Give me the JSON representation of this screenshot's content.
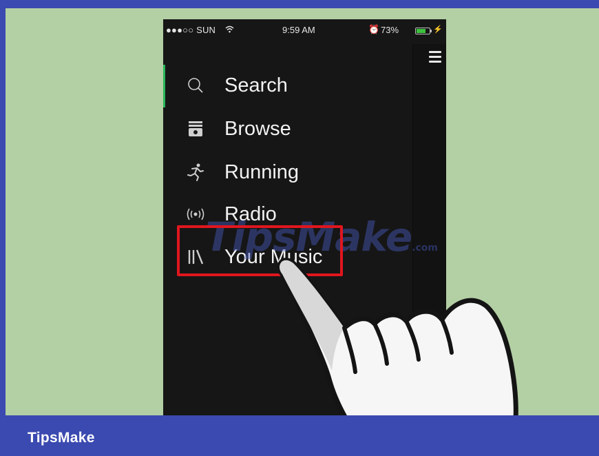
{
  "status_bar": {
    "carrier": "●●●○○ SUN",
    "wifi_icon": "wifi-icon",
    "time": "9:59 AM",
    "alarm_icon": "alarm-icon",
    "battery_percent": "73%",
    "battery_level": 0.73,
    "battery_color": "#3cc23c",
    "charging_icon": "bolt-icon"
  },
  "menu": {
    "items": [
      {
        "label": "Search",
        "icon": "search-icon",
        "active": true
      },
      {
        "label": "Browse",
        "icon": "browse-icon"
      },
      {
        "label": "Running",
        "icon": "running-icon"
      },
      {
        "label": "Radio",
        "icon": "radio-icon"
      },
      {
        "label": "Your Music",
        "icon": "your-music-icon",
        "highlighted": true
      }
    ],
    "active_color": "#2ab759",
    "highlight_color": "#e0161e"
  },
  "hamburger_icon": "hamburger-menu-icon",
  "watermark": {
    "text": "TipsMake",
    "suffix": ".com"
  },
  "footer": {
    "brand": "TipsMake"
  },
  "colors": {
    "frame": "#3b4ab0",
    "background": "#b3cfa4",
    "phone": "#161616"
  }
}
